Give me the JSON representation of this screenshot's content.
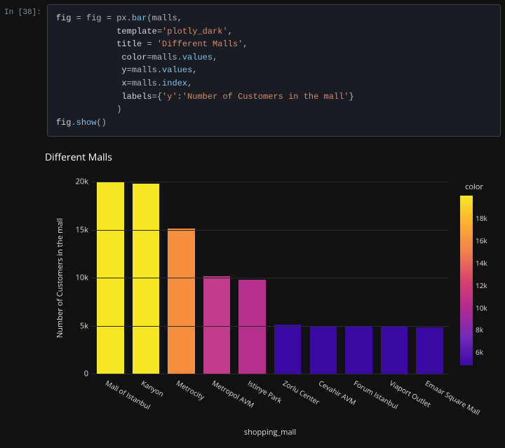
{
  "cell": {
    "prompt": "In [38]:",
    "code": {
      "l1a": "fig ",
      "l1b": "= fig = px",
      "l1c": ".bar",
      "l1d": "(malls,",
      "l2a": "            template",
      "l2b": "=",
      "l2c": "'plotly_dark'",
      "l2d": ",",
      "l3a": "            title ",
      "l3b": "= ",
      "l3c": "'Different Malls'",
      "l3d": ",",
      "l4a": "             color",
      "l4b": "=malls",
      "l4c": ".values",
      "l4d": ",",
      "l5a": "             y",
      "l5b": "=malls",
      "l5c": ".values",
      "l5d": ",",
      "l6a": "             x",
      "l6b": "=malls",
      "l6c": ".index",
      "l6d": ",",
      "l7a": "             labels",
      "l7b": "={",
      "l7c": "'y'",
      "l7d": ":",
      "l7e": "'Number of Customers in the mall'",
      "l7f": "}",
      "l8": "            )",
      "l9a": "fig",
      "l9b": ".show",
      "l9c": "()"
    }
  },
  "chart_data": {
    "type": "bar",
    "title": "Different Malls",
    "xlabel": "shopping_mall",
    "ylabel": "Number of Customers in the mall",
    "ylim": [
      0,
      20000
    ],
    "yticks": [
      0,
      5000,
      10000,
      15000,
      20000
    ],
    "ytick_labels": [
      "0",
      "5k",
      "10k",
      "15k",
      "20k"
    ],
    "categories": [
      "Mall of Istanbul",
      "Kanyon",
      "Metrocity",
      "Metropol AVM",
      "Istinye Park",
      "Zorlu Center",
      "Cevahir AVM",
      "Forum Istanbul",
      "Viaport Outlet",
      "Emaar Square Mall"
    ],
    "values": [
      19950,
      19800,
      15100,
      10200,
      9800,
      5100,
      5000,
      4950,
      4900,
      4830
    ],
    "bar_colors": [
      "#f6e726",
      "#f6e726",
      "#f58e3f",
      "#c13a8c",
      "#b52f8d",
      "#3b0aa5",
      "#3b0aa5",
      "#3b0aa5",
      "#3b0aa5",
      "#3b0aa5"
    ],
    "colorbar": {
      "title": "color",
      "ticks": [
        6000,
        8000,
        10000,
        12000,
        14000,
        16000,
        18000
      ],
      "tick_labels": [
        "6k",
        "8k",
        "10k",
        "12k",
        "14k",
        "16k",
        "18k"
      ],
      "min": 4800,
      "max": 20000
    }
  }
}
